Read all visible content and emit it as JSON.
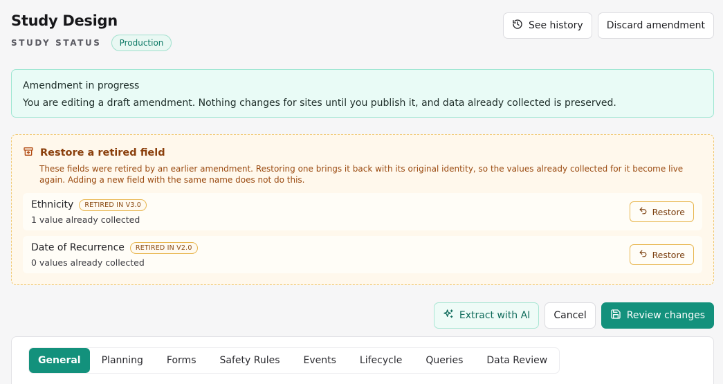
{
  "header": {
    "title": "Study Design",
    "status_label": "STUDY STATUS",
    "status_value": "Production",
    "see_history": "See history",
    "discard": "Discard amendment"
  },
  "notice": {
    "title": "Amendment in progress",
    "body": "You are editing a draft amendment. Nothing changes for sites until you publish it, and data already collected is preserved."
  },
  "retired": {
    "title": "Restore a retired field",
    "description": "These fields were retired by an earlier amendment. Restoring one brings it back with its original identity, so the values already collected for it become live again. Adding a new field with the same name does not do this.",
    "fields": [
      {
        "name": "Ethnicity",
        "badge": "RETIRED IN V3.0",
        "sub": "1 value already collected",
        "action": "Restore"
      },
      {
        "name": "Date of Recurrence",
        "badge": "RETIRED IN V2.0",
        "sub": "0 values already collected",
        "action": "Restore"
      }
    ]
  },
  "actions": {
    "extract": "Extract with AI",
    "cancel": "Cancel",
    "review": "Review changes"
  },
  "tabs": [
    "General",
    "Planning",
    "Forms",
    "Safety Rules",
    "Events",
    "Lifecycle",
    "Queries",
    "Data Review"
  ],
  "active_tab": "General",
  "colors": {
    "accent": "#13917c",
    "notice_bg": "#e9fbf6",
    "warning_bg": "#fff8ec",
    "warning_text": "#8a3f0c"
  },
  "icons": {
    "history": "history-icon",
    "retired": "archive-icon",
    "restore": "undo-icon",
    "extract": "sparkles-icon",
    "review": "save-icon"
  }
}
